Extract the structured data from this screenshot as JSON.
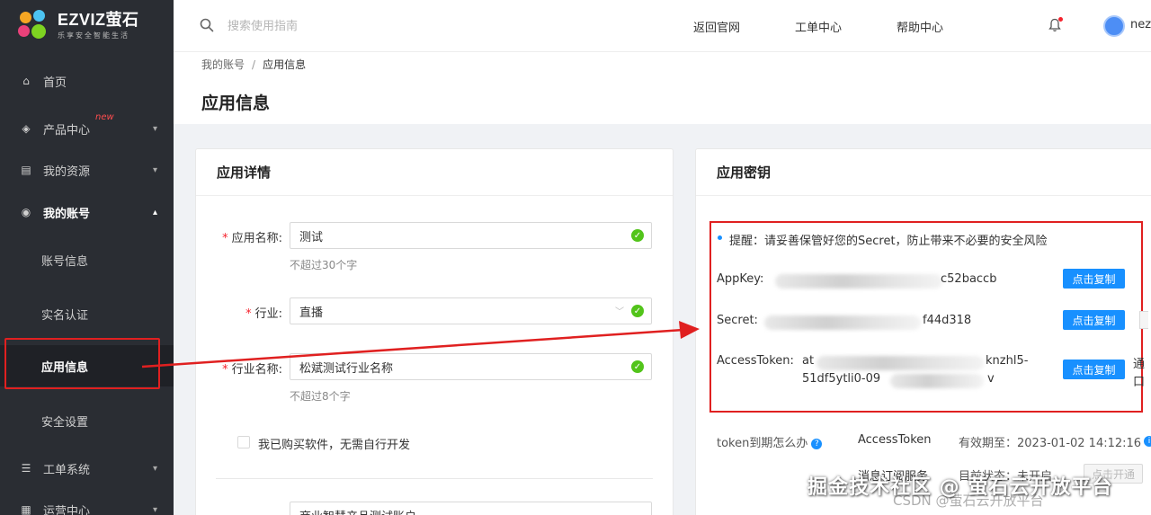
{
  "brand": {
    "name": "EZVIZ萤石",
    "slogan": "乐享安全智能生活"
  },
  "header": {
    "search_placeholder": "搜索使用指南",
    "links": [
      "返回官网",
      "工单中心",
      "帮助中心"
    ],
    "user": "nez"
  },
  "sidebar": {
    "items": [
      {
        "label": "首页",
        "icon": "home-icon"
      },
      {
        "label": "产品中心",
        "icon": "cube-icon",
        "badge": "new"
      },
      {
        "label": "我的资源",
        "icon": "document-icon"
      },
      {
        "label": "我的账号",
        "icon": "user-circle-icon"
      },
      {
        "label": "工单系统",
        "icon": "list-icon"
      },
      {
        "label": "运营中心",
        "icon": "chart-icon"
      }
    ],
    "account_sub": [
      "账号信息",
      "实名认证",
      "应用信息",
      "安全设置"
    ]
  },
  "breadcrumb": {
    "parent": "我的账号",
    "sep": "/",
    "current": "应用信息"
  },
  "page_title": "应用信息",
  "detail": {
    "title": "应用详情",
    "name_label": "应用名称:",
    "name_value": "测试",
    "name_hint": "不超过30个字",
    "industry_label": "行业:",
    "industry_value": "直播",
    "industry_name_label": "行业名称:",
    "industry_name_value": "松斌测试行业名称",
    "industry_name_hint": "不超过8个字",
    "checkbox_label": "我已购买软件，无需自行开发",
    "next_value": "商业智慧产品测试账户"
  },
  "keys": {
    "title": "应用密钥",
    "tip": "提醒：请妥善保管好您的Secret，防止带来不必要的安全风险",
    "appkey_label": "AppKey:",
    "appkey_value": "c52baccb",
    "secret_label": "Secret:",
    "secret_value": "f44d318",
    "token_label": "AccessToken:",
    "token_line1_a": "at",
    "token_line1_b": "knzhl5-",
    "token_line2": "51df5ytli0-09",
    "token_line2_end": "v",
    "copy_label": "点击复制",
    "side_char1": "通",
    "side_char2": "口",
    "expire_q": "token到期怎么办",
    "expire_name": "AccessToken",
    "expire_value": "有效期至：2023-01-02 14:12:16",
    "msg_label": "消息订阅服务",
    "msg_status": "目前状态：未开启",
    "msg_btn": "点击开通"
  },
  "watermark": {
    "main": "掘金技术社区 @ 萤石云开放平台",
    "sub": "CSDN @萤石云开放平台"
  }
}
